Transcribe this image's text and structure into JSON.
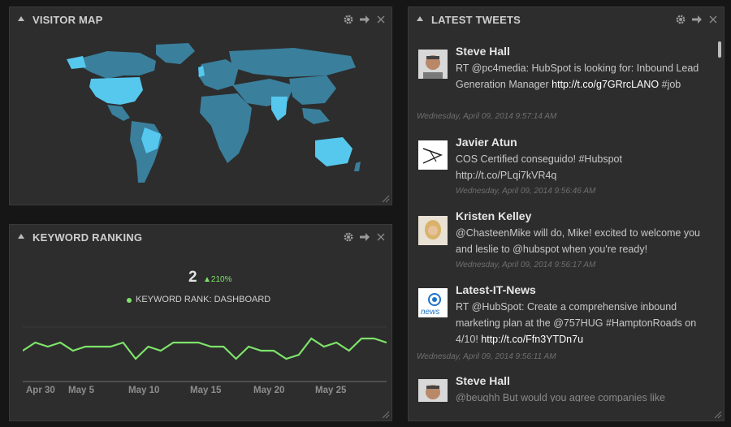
{
  "panels": {
    "visitor_map": {
      "title": "VISITOR MAP"
    },
    "keyword_ranking": {
      "title": "KEYWORD RANKING",
      "rank_value": "2",
      "delta": "210%",
      "legend": "KEYWORD RANK: DASHBOARD",
      "x_labels": [
        "Apr 30",
        "May 5",
        "May 10",
        "May 15",
        "May 20",
        "May 25"
      ]
    },
    "latest_tweets": {
      "title": "LATEST TWEETS"
    }
  },
  "tweets": [
    {
      "name": "Steve Hall",
      "text": "RT @pc4media: HubSpot is looking for: Inbound Lead Generation Manager ",
      "link": "http://t.co/g7GRrcLANO",
      "text_after": " #job",
      "time": "Wednesday, April 09, 2014 9:57:14 AM"
    },
    {
      "name": "Javier Atun",
      "text": "COS Certified conseguido! #Hubspot http://t.co/PLqi7kVR4q",
      "link": "",
      "text_after": "",
      "time": "Wednesday, April 09, 2014 9:56:46 AM"
    },
    {
      "name": "Kristen Kelley",
      "text": "@ChasteenMike will do, Mike! excited to welcome you and leslie to @hubspot when you're ready!",
      "link": "",
      "text_after": "",
      "time": "Wednesday, April 09, 2014 9:56:17 AM"
    },
    {
      "name": "Latest-IT-News",
      "text": "RT @HubSpot: Create a comprehensive inbound marketing plan at the @757HUG #HamptonRoads on 4/10! ",
      "link": "http://t.co/Ffn3YTDn7u",
      "text_after": "",
      "time": "Wednesday, April 09, 2014 9:56:11 AM"
    },
    {
      "name": "Steve Hall",
      "text": "@beughh But would you agree companies like",
      "link": "",
      "text_after": "",
      "time": ""
    }
  ],
  "chart_data": {
    "type": "line",
    "series": [
      {
        "values": [
          7,
          9,
          8,
          9,
          7,
          8,
          8,
          8,
          9,
          5,
          8,
          7,
          9,
          9,
          9,
          8,
          8,
          5,
          8,
          7,
          7,
          5,
          6,
          10,
          8,
          9,
          7,
          10,
          10,
          9
        ]
      }
    ],
    "x_tick_labels": [
      "Apr 30",
      "May 5",
      "May 10",
      "May 15",
      "May 20",
      "May 25"
    ],
    "color": "#7ee36a",
    "grid": true
  },
  "colors": {
    "map_land": "#3a7f9c",
    "map_highlight": "#56c8ee",
    "accent_green": "#7ee36a"
  }
}
